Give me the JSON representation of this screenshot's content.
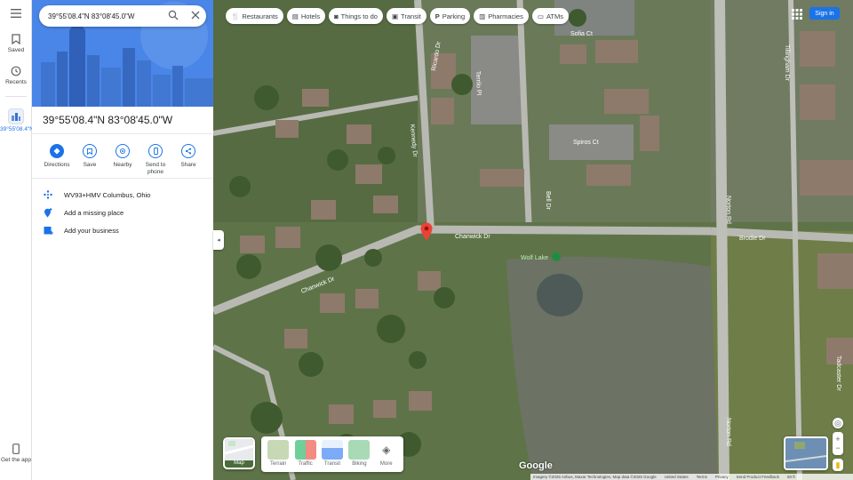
{
  "rail": {
    "saved_label": "Saved",
    "recents_label": "Recents",
    "recent_place_label": "39°55'08.4\"N",
    "get_app_label": "Get the app"
  },
  "search": {
    "value": "39°55'08.4\"N 83°08'45.0\"W"
  },
  "place": {
    "title": "39°55'08.4\"N 83°08'45.0\"W"
  },
  "actions": [
    {
      "label": "Directions",
      "icon": "directions-icon"
    },
    {
      "label": "Save",
      "icon": "bookmark-icon"
    },
    {
      "label": "Nearby",
      "icon": "nearby-icon"
    },
    {
      "label": "Send to phone",
      "icon": "phone-icon"
    },
    {
      "label": "Share",
      "icon": "share-icon"
    }
  ],
  "info": {
    "plus_code": "WV93+HMV Columbus, Ohio",
    "add_missing": "Add a missing place",
    "add_business": "Add your business"
  },
  "chips": [
    {
      "label": "Restaurants",
      "icon": "fork-knife-icon"
    },
    {
      "label": "Hotels",
      "icon": "bed-icon"
    },
    {
      "label": "Things to do",
      "icon": "camera-icon"
    },
    {
      "label": "Transit",
      "icon": "train-icon"
    },
    {
      "label": "Parking",
      "icon": "parking-icon"
    },
    {
      "label": "Pharmacies",
      "icon": "pharmacy-icon"
    },
    {
      "label": "ATMs",
      "icon": "atm-icon"
    }
  ],
  "header": {
    "signin_label": "Sign in"
  },
  "layers": {
    "map_label": "Map",
    "options": [
      "Terrain",
      "Traffic",
      "Transit",
      "Biking",
      "More"
    ]
  },
  "map": {
    "logo": "Google",
    "attribution": [
      "Imagery ©2025 Airbus, Maxar Technologies, Map data ©2025 Google",
      "United States",
      "Terms",
      "Privacy",
      "Send Product Feedback",
      "50 ft"
    ],
    "streets": [
      "Ricardo Dr",
      "Kennedy Dr",
      "Terrilo Pl",
      "Chanwick Dr",
      "Chanwick Dr",
      "Spiros Ct",
      "Sofia Ct",
      "Bell Dr",
      "Norton Rd",
      "Norton Rd",
      "Tillingham Dr",
      "Brodie Dr",
      "Tadcaster Dr",
      "Wolf Lake"
    ]
  },
  "colors": {
    "accent": "#1a73e8",
    "pin": "#ea4335"
  }
}
